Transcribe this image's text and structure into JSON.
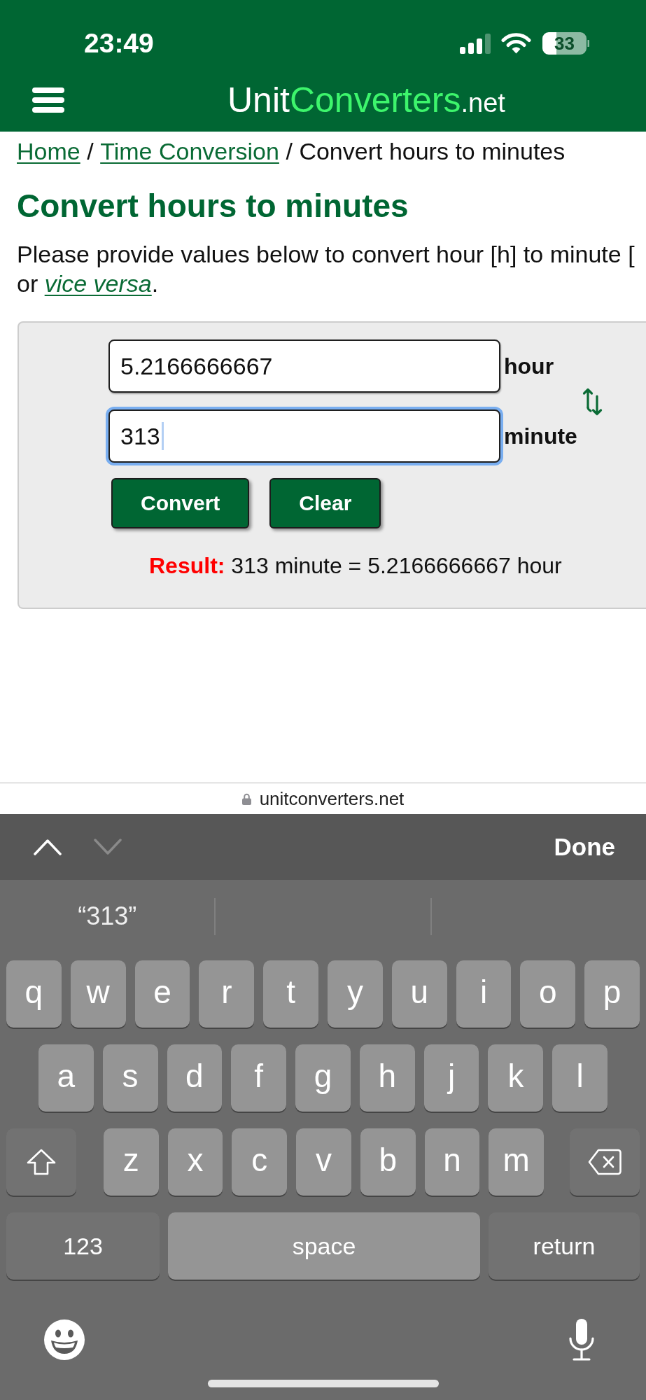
{
  "status_bar": {
    "time": "23:49",
    "battery": "33"
  },
  "header": {
    "logo": [
      {
        "text": "Unit",
        "kind": "plain"
      },
      {
        "text": "Converters",
        "kind": "accent"
      },
      {
        "text": ".net",
        "kind": "suffix"
      }
    ]
  },
  "breadcrumb": [
    {
      "text": "Home",
      "kind": "link"
    },
    {
      "text": "/",
      "kind": "separator"
    },
    {
      "text": "Time Conversion",
      "kind": "link"
    },
    {
      "text": "/",
      "kind": "separator"
    },
    {
      "text": "Convert hours to minutes",
      "kind": "current"
    }
  ],
  "title": "Convert hours to minutes",
  "intro": {
    "line_1": "Please provide values below to convert hour [h] to minute [",
    "line_2_start": "or",
    "link": "vice versa",
    "line_2_end": "."
  },
  "converter": {
    "fields": [
      {
        "value": "5.2166666667",
        "unit": "hour",
        "focused": false
      },
      {
        "value": "313",
        "unit": "minute",
        "focused": true
      }
    ],
    "buttons": [
      "Convert",
      "Clear"
    ],
    "result": {
      "label": "Result:",
      "text": "313 minute = 5.2166666667 hour"
    }
  },
  "address_bar": {
    "domain": "unitconverters.net"
  },
  "keyboard_toolbar": {
    "nav": [
      {
        "kind": "up",
        "disabled": false
      },
      {
        "kind": "down",
        "disabled": true
      }
    ],
    "done": "Done"
  },
  "suggestions": [
    "“313”"
  ],
  "keyboard": {
    "rows": [
      {
        "keys": [
          {
            "kind": "letter",
            "label": "q"
          },
          {
            "kind": "letter",
            "label": "w"
          },
          {
            "kind": "letter",
            "label": "e"
          },
          {
            "kind": "letter",
            "label": "r"
          },
          {
            "kind": "letter",
            "label": "t"
          },
          {
            "kind": "letter",
            "label": "y"
          },
          {
            "kind": "letter",
            "label": "u"
          },
          {
            "kind": "letter",
            "label": "i"
          },
          {
            "kind": "letter",
            "label": "o"
          },
          {
            "kind": "letter",
            "label": "p"
          }
        ]
      },
      {
        "keys": [
          {
            "kind": "letter",
            "label": "a"
          },
          {
            "kind": "letter",
            "label": "s"
          },
          {
            "kind": "letter",
            "label": "d"
          },
          {
            "kind": "letter",
            "label": "f"
          },
          {
            "kind": "letter",
            "label": "g"
          },
          {
            "kind": "letter",
            "label": "h"
          },
          {
            "kind": "letter",
            "label": "j"
          },
          {
            "kind": "letter",
            "label": "k"
          },
          {
            "kind": "letter",
            "label": "l"
          }
        ]
      },
      {
        "keys": [
          {
            "kind": "shift",
            "on": false
          },
          {
            "kind": "letter",
            "label": "z"
          },
          {
            "kind": "letter",
            "label": "x"
          },
          {
            "kind": "letter",
            "label": "c"
          },
          {
            "kind": "letter",
            "label": "v"
          },
          {
            "kind": "letter",
            "label": "b"
          },
          {
            "kind": "letter",
            "label": "n"
          },
          {
            "kind": "letter",
            "label": "m"
          },
          {
            "kind": "delete"
          }
        ]
      },
      {
        "keys": [
          {
            "kind": "mode",
            "label": "123"
          },
          {
            "kind": "space",
            "label": "space"
          },
          {
            "kind": "return",
            "label": "return"
          }
        ]
      }
    ]
  }
}
